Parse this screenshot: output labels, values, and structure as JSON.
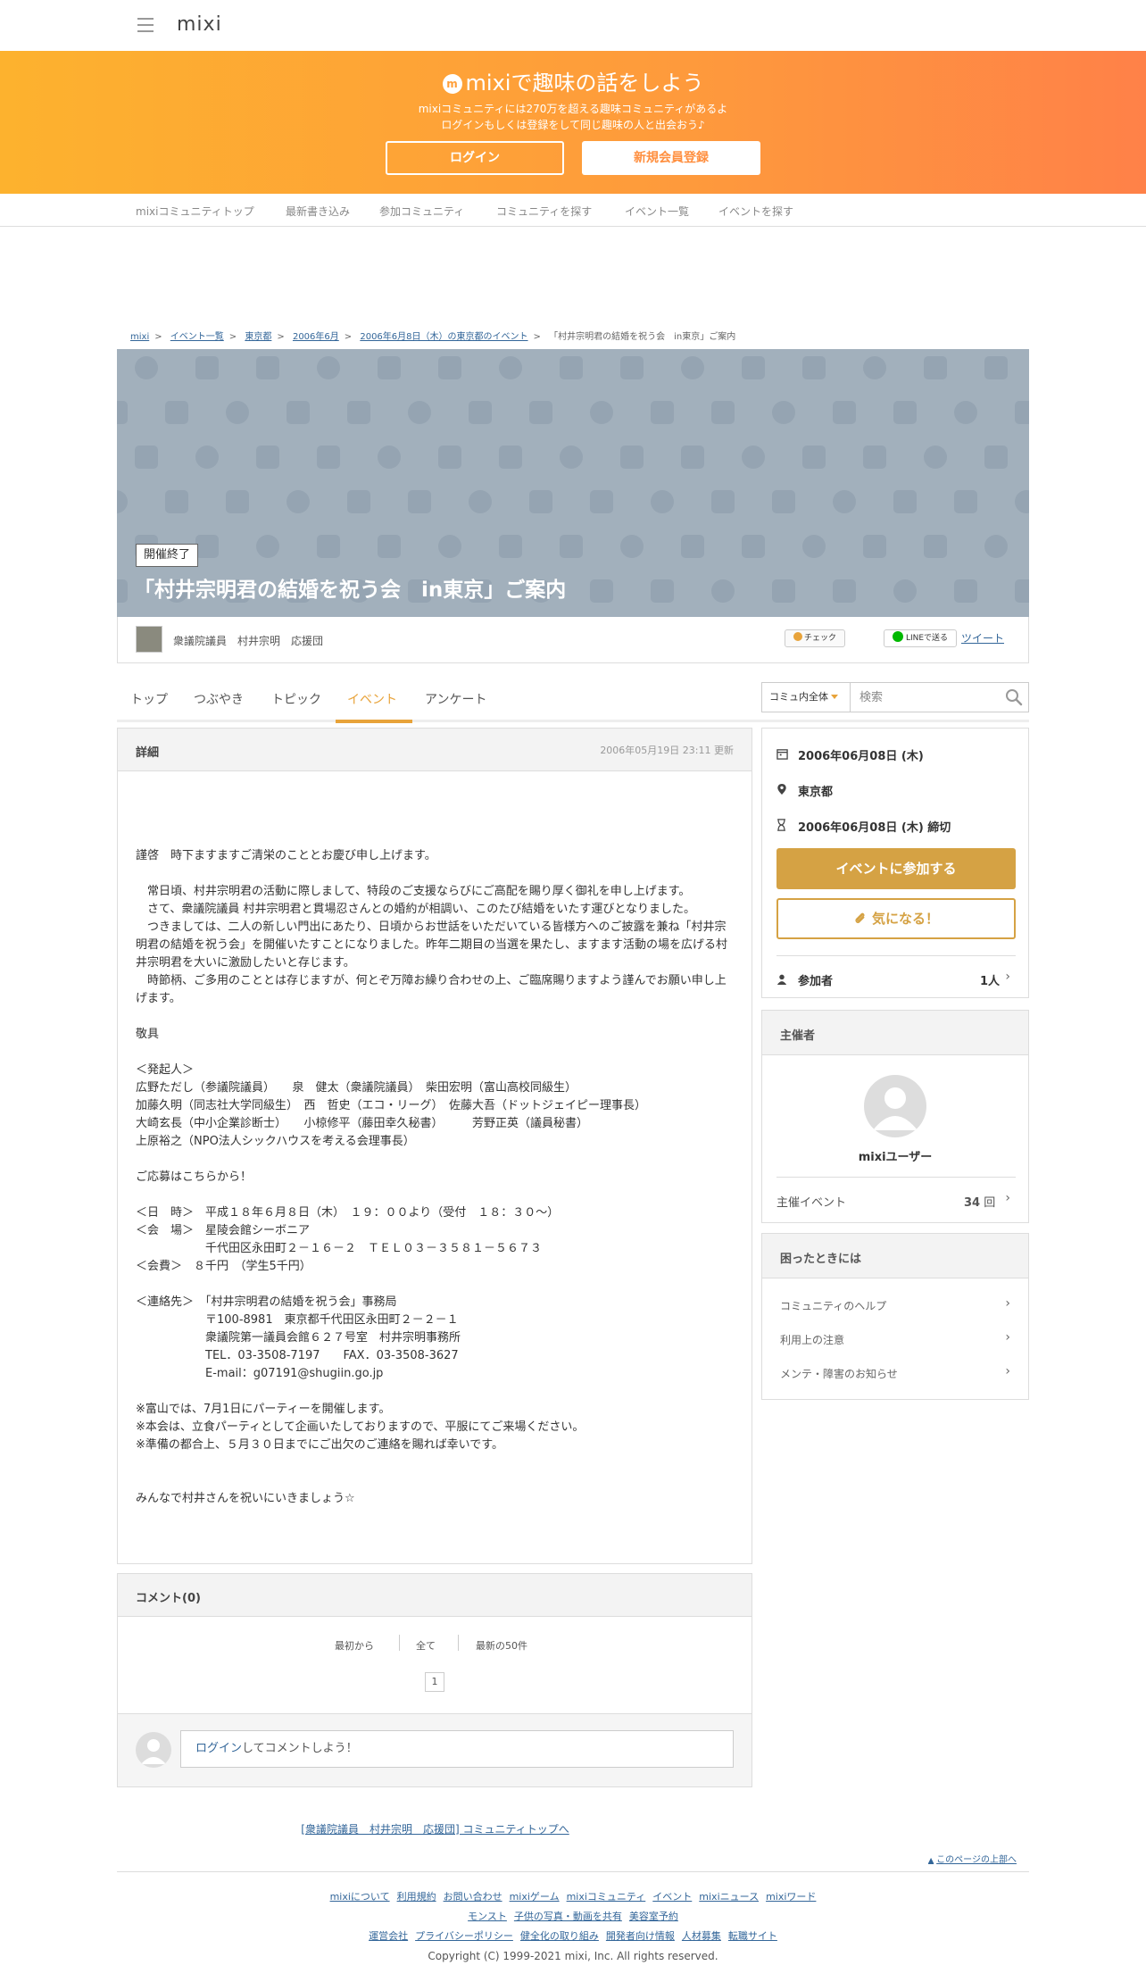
{
  "header": {
    "logo": "mixi",
    "menu_icon": "hamburger-icon"
  },
  "banner": {
    "title": "mixiで趣味の話をしよう",
    "logo_glyph": "m",
    "line1": "mixiコミュニティには270万を超える趣味コミュニティがあるよ",
    "line2": "ログインもしくは登録をして同じ趣味の人と出会おう♪",
    "login": "ログイン",
    "register": "新規会員登録",
    "colors": {
      "from": "#fdb22e",
      "to": "#ff8148"
    }
  },
  "nav": [
    "mixiコミュニティトップ",
    "最新書き込み",
    "参加コミュニティ",
    "コミュニティを探す",
    "イベント一覧",
    "イベントを探す"
  ],
  "breadcrumb": {
    "items": [
      "mixi",
      "イベント一覧",
      "東京都",
      "2006年6月",
      "2006年6月8日（木）の東京都のイベント"
    ],
    "current": "「村井宗明君の結婚を祝う会　in東京」ご案内",
    "separator": ">"
  },
  "event": {
    "status": "開催終了",
    "title": "「村井宗明君の結婚を祝う会　in東京」ご案内",
    "community_name": "衆議院議員　村井宗明　応援団",
    "check_label": "チェック",
    "line_label": "LINEで送る",
    "tweet_label": "ツイート"
  },
  "tabs": [
    "トップ",
    "つぶやき",
    "トピック",
    "イベント",
    "アンケート"
  ],
  "active_tab": "イベント",
  "search": {
    "scope": "コミュ内全体",
    "placeholder": "検索"
  },
  "detail": {
    "heading": "詳細",
    "updated": "2006年05月19日 23:11 更新",
    "body": "謹啓　時下ますますご清栄のこととお慶び申し上げます。\n\n　常日頃、村井宗明君の活動に際しまして、特段のご支援ならびにご高配を賜り厚く御礼を申し上げます。\n　さて、衆議院議員 村井宗明君と貫場忍さんとの婚約が相調い、このたび結婚をいたす運びとなりました。\n　つきましては、二人の新しい門出にあたり、日頃からお世話をいただいている皆様方へのご披露を兼ね「村井宗明君の結婚を祝う会」を開催いたすことになりました。昨年二期目の当選を果たし、ますます活動の場を広げる村井宗明君を大いに激励したいと存じます。\n　時節柄、ご多用のこととは存じますが、何とぞ万障お繰り合わせの上、ご臨席賜りますよう謹んでお願い申し上げます。\n\n敬具\n\n＜発起人＞\n広野ただし（参議院議員）　　泉　健太（衆議院議員）　柴田宏明（富山高校同級生）\n加藤久明（同志社大学同級生）　西　哲史（エコ・リーグ）　佐藤大吾（ドットジェイピー理事長）\n大崎玄長（中小企業診断士）　　小椋修平（藤田幸久秘書）　　　芳野正英（議員秘書）\n上原裕之（NPO法人シックハウスを考える会理事長）\n\nご応募はこちらから！\n\n＜日　時＞　平成１８年６月８日（木）　１９：００より（受付　１８：３０～）\n＜会　場＞　星陵会館シーボニア\n　　　　　　千代田区永田町２－１６－２　ＴＥＬ０３－３５８１－５６７３\n＜会費＞　８千円　（学生5千円）\n\n＜連絡先＞　「村井宗明君の結婚を祝う会」事務局\n　　　　　　〒100-8981　東京都千代田区永田町２－２－１\n　　　　　　衆議院第一議員会館６２７号室　村井宗明事務所\n　　　　　　TEL．03-3508-7197　　FAX．03-3508-3627\n　　　　　　E-mail：g07191@shugiin.go.jp\n\n※富山では、7月1日にパーティーを開催します。\n※本会は、立食パーティとして企画いたしておりますので、平服にてご来場ください。\n※準備の都合上、５月３０日までにご出欠のご連絡を賜れば幸いです。\n\n\nみんなで村井さんを祝いにいきましょう☆"
  },
  "comments": {
    "heading": "コメント(0)",
    "pager": [
      "最初から",
      "全て",
      "最新の50件"
    ],
    "page": "1",
    "login_link": "ログイン",
    "prompt_suffix": "してコメントしよう！"
  },
  "sidebar": {
    "date": "2006年06月08日 (木)",
    "place": "東京都",
    "deadline": "2006年06月08日 (木) 締切",
    "join": "イベントに参加する",
    "fav": "気になる！",
    "participants_label": "参加者",
    "participants_value": "1人",
    "organizer_heading": "主催者",
    "organizer_name": "mixiユーザー",
    "hosted_label": "主催イベント",
    "hosted_count": "34",
    "hosted_unit": "回",
    "help_heading": "困ったときには",
    "help_items": [
      "コミュニティのヘルプ",
      "利用上の注意",
      "メンテ・障害のお知らせ"
    ],
    "accent": "#d5a244"
  },
  "footer": {
    "back_link": "[衆議院議員　村井宗明　応援団] コミュニティトップへ",
    "page_top": "このページの上部へ",
    "row1": [
      "mixiについて",
      "利用規約",
      "お問い合わせ",
      "mixiゲーム",
      "mixiコミュニティ",
      "イベント",
      "mixiニュース",
      "mixiワード"
    ],
    "row2": [
      "モンスト",
      "子供の写真・動画を共有",
      "美容室予約"
    ],
    "row3": [
      "運営会社",
      "プライバシーポリシー",
      "健全化の取り組み",
      "開発者向け情報",
      "人材募集",
      "転職サイト"
    ],
    "copyright": "Copyright (C) 1999-2021 mixi, Inc. All rights reserved."
  }
}
